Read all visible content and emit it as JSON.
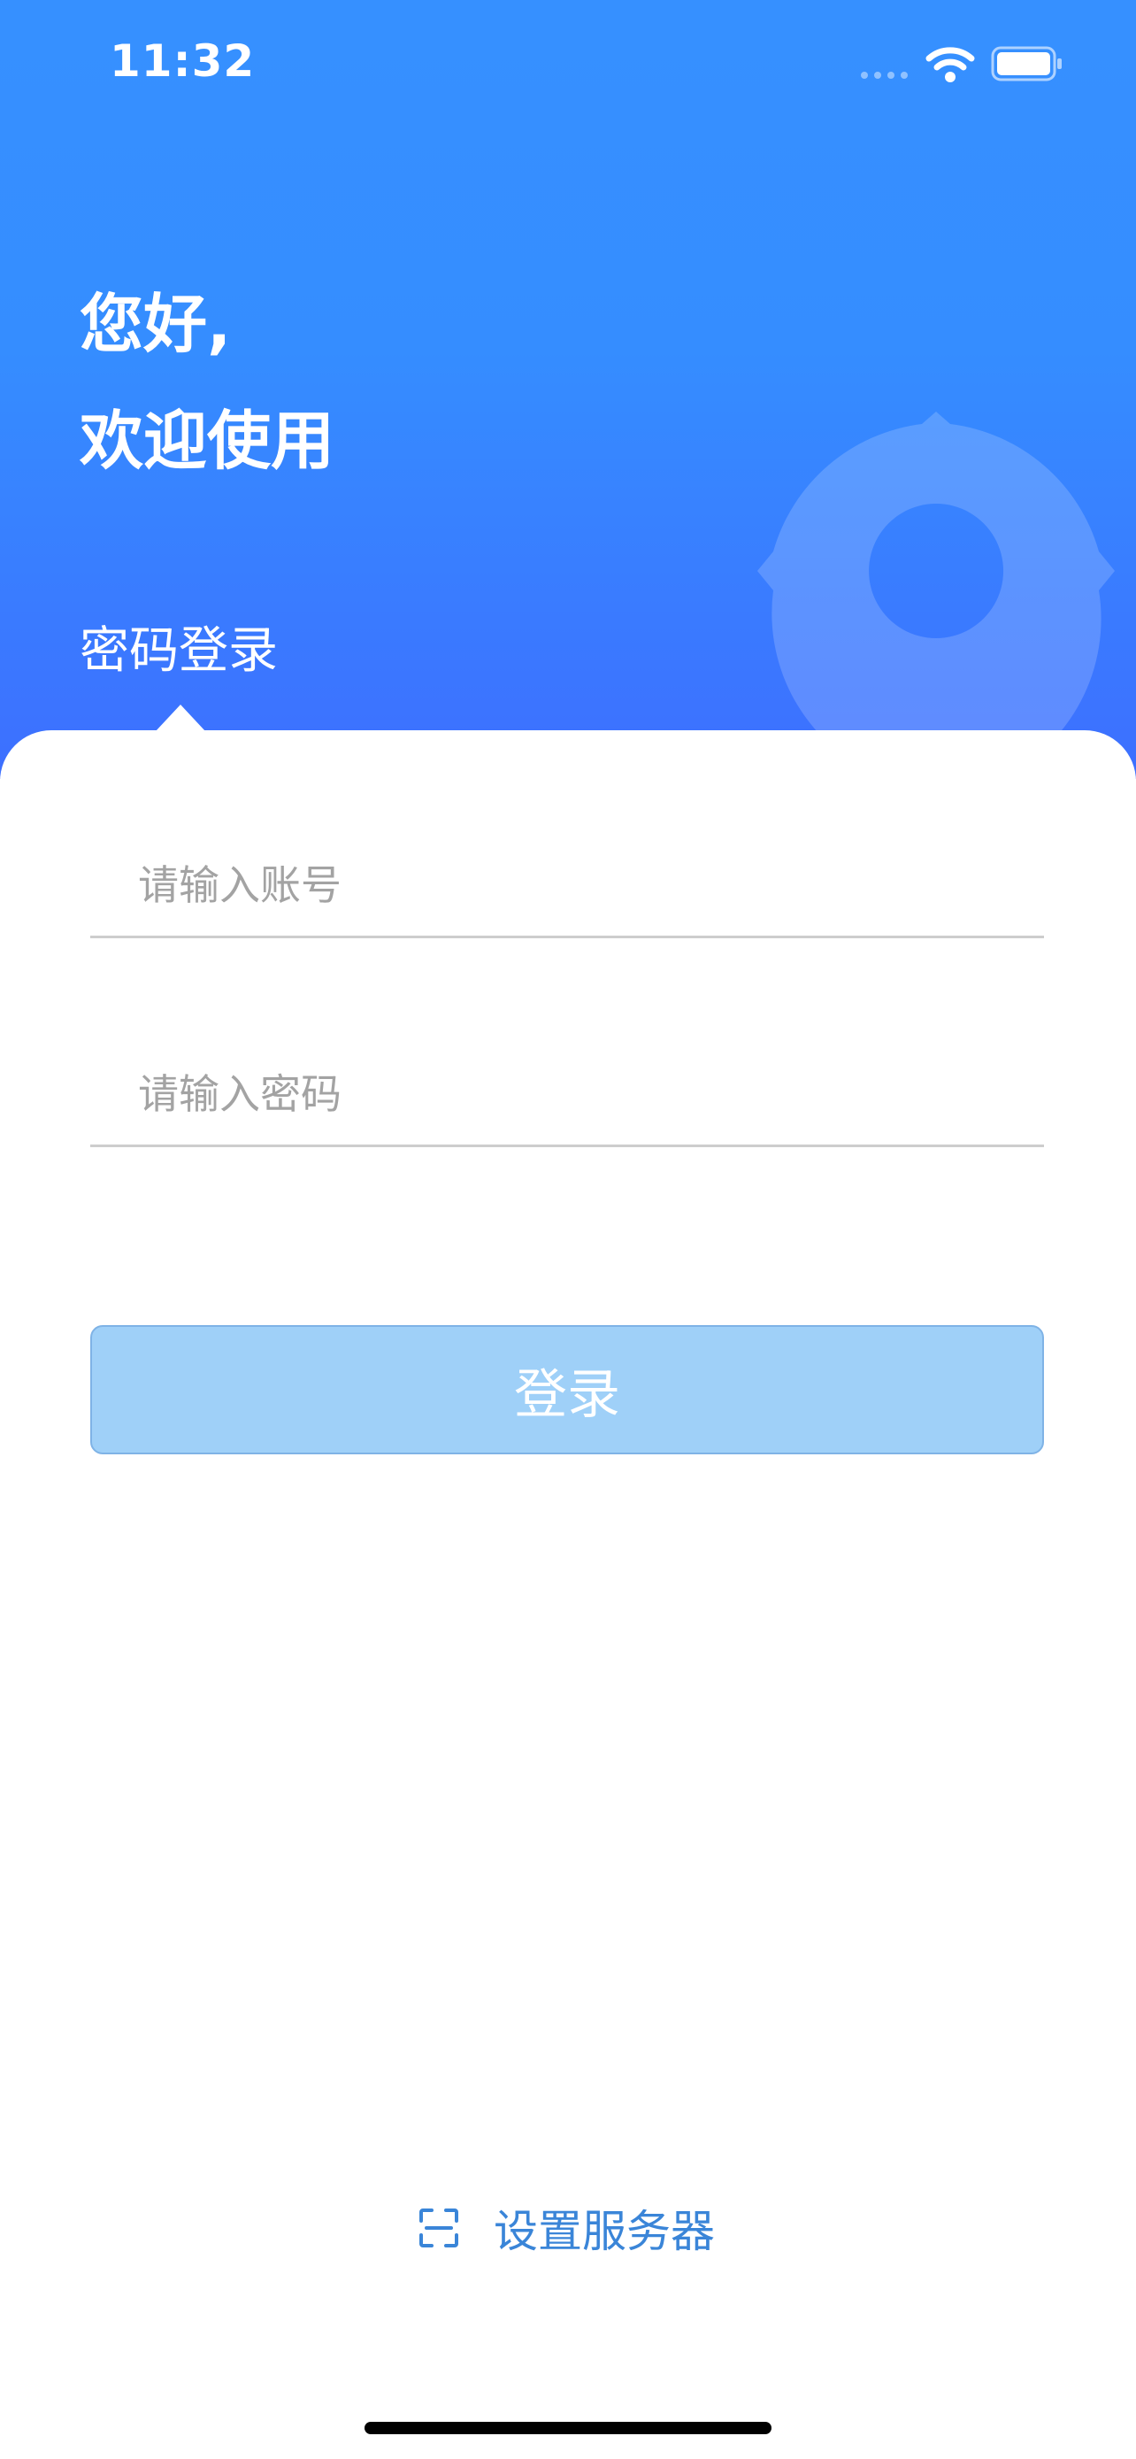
{
  "status_bar": {
    "time": "11:32",
    "icons": [
      "signal-dots-icon",
      "wifi-icon",
      "battery-icon"
    ]
  },
  "header": {
    "greeting_line1": "您好,",
    "greeting_line2": "欢迎使用",
    "tab_label": "密码登录",
    "watermark_icon": "logo-watermark-icon"
  },
  "form": {
    "account_placeholder": "请输入账号",
    "account_value": "",
    "password_placeholder": "请输入密码",
    "password_value": "",
    "login_label": "登录"
  },
  "footer": {
    "server_icon": "scan-icon",
    "server_label": "设置服务器"
  },
  "colors": {
    "header_top": "#3690ff",
    "header_bottom": "#3d6fff",
    "login_button": "#9fd0f8",
    "link": "#3a85d8"
  }
}
